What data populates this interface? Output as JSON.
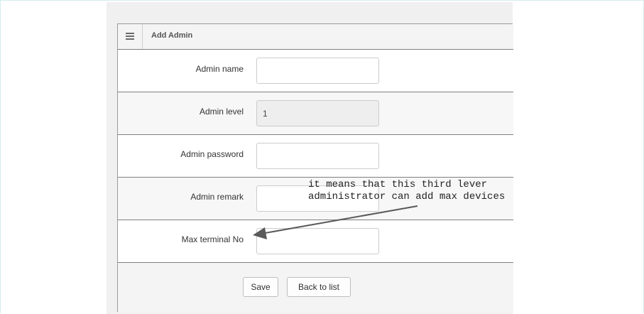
{
  "panel": {
    "title": "Add Admin",
    "menu_icon": "menu-icon"
  },
  "form": {
    "rows": [
      {
        "label": "Admin name",
        "value": ""
      },
      {
        "label": "Admin level",
        "value": "1",
        "disabled": true
      },
      {
        "label": "Admin password",
        "value": ""
      },
      {
        "label": "Admin remark",
        "value": ""
      },
      {
        "label": "Max terminal No",
        "value": ""
      }
    ]
  },
  "buttons": {
    "save_label": "Save",
    "back_label": "Back to list"
  },
  "annotation": {
    "line1": "it means that this third lever",
    "line2": "administrator can add max devices",
    "color": "#5a5a5a"
  }
}
